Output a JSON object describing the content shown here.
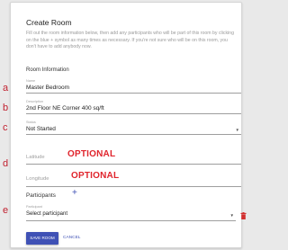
{
  "dialog": {
    "title": "Create Room",
    "intro": "Fill out the room information below, then add any participants who will be part of this room by clicking on the blue + symbol as many times as necessary. If you're not sure who will be on this room, you don't have to add anybody now.",
    "section_title": "Room Information"
  },
  "markers": {
    "a": "a",
    "b": "b",
    "c": "c",
    "d": "d",
    "e": "e"
  },
  "fields": {
    "name": {
      "label": "Name",
      "value": "Master Bedroom"
    },
    "description": {
      "label": "Description",
      "value": "2nd Floor NE Corner 400 sq/ft"
    },
    "status": {
      "label": "Status",
      "value": "Not Started"
    },
    "latitude": {
      "placeholder": "Latitude",
      "annotation": "OPTIONAL"
    },
    "longitude": {
      "placeholder": "Longitude",
      "annotation": "OPTIONAL"
    }
  },
  "participants": {
    "heading": "Participants",
    "add_symbol": "+",
    "label": "Participant",
    "select_value": "Select participant"
  },
  "actions": {
    "save_label": "SAVE ROOM",
    "cancel_label": "CANCEL"
  },
  "colors": {
    "accent": "#3f51b5",
    "marker": "#c0202f",
    "optional": "#e0242c",
    "delete": "#d32f2f"
  },
  "icons": {
    "status_dropdown": "caret-down-icon",
    "participant_dropdown": "caret-down-icon",
    "delete": "trash-icon",
    "add": "plus-icon"
  }
}
